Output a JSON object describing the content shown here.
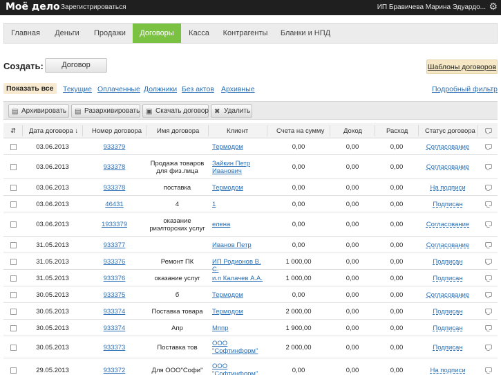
{
  "topbar": {
    "logo": "Моё дело",
    "register": "Зарегистрироваться",
    "user": "ИП Бравичева Марина Эдуардо..."
  },
  "nav": [
    "Главная",
    "Деньги",
    "Продажи",
    "Договоры",
    "Касса",
    "Контрагенты",
    "Бланки и НПД"
  ],
  "create": {
    "label": "Создать:",
    "contract_button": "Договор",
    "templates_button": "Шаблоны договоров"
  },
  "filters": {
    "show_all": "Показать все",
    "current": "Текущие",
    "paid": "Оплаченные",
    "debtors": "Должники",
    "no_acts": "Без актов",
    "archive": "Архивные",
    "advanced": "Подробный фильтр"
  },
  "toolbar": {
    "archive": "Архивировать",
    "unarchive": "Разархивировать",
    "download": "Скачать договор",
    "delete": "Удалить"
  },
  "columns": {
    "date": "Дата договора ↓",
    "number": "Номер договора",
    "name": "Имя договора",
    "client": "Клиент",
    "bills": "Счета на сумму",
    "income": "Доход",
    "expense": "Расход",
    "status": "Статус договора"
  },
  "rows": [
    {
      "date": "03.06.2013",
      "number": "933379",
      "name": "",
      "client": "Термодом",
      "bills": "0,00",
      "income": "0,00",
      "expense": "0,00",
      "status": "Согласование"
    },
    {
      "date": "03.06.2013",
      "number": "933378",
      "name": "Продажа товаров для физ.лица",
      "client": "Зайкин Петр Иванович",
      "bills": "0,00",
      "income": "0,00",
      "expense": "0,00",
      "status": "Согласование"
    },
    {
      "date": "03.06.2013",
      "number": "933378",
      "name": "поставка",
      "client": "Термодом",
      "bills": "0,00",
      "income": "0,00",
      "expense": "0,00",
      "status": "На подписи"
    },
    {
      "date": "03.06.2013",
      "number": "46431",
      "name": "4",
      "client": "1",
      "bills": "0,00",
      "income": "0,00",
      "expense": "0,00",
      "status": "Подписан"
    },
    {
      "date": "03.06.2013",
      "number": "1933379",
      "name": "оказание риэлторских услуг",
      "client": "елена",
      "bills": "0,00",
      "income": "0,00",
      "expense": "0,00",
      "status": "Согласование"
    },
    {
      "date": "31.05.2013",
      "number": "933377",
      "name": "",
      "client": "Иванов Петр",
      "bills": "0,00",
      "income": "0,00",
      "expense": "0,00",
      "status": "Согласование"
    },
    {
      "date": "31.05.2013",
      "number": "933376",
      "name": "Ремонт ПК",
      "client": "ИП Родионов В. С.",
      "bills": "1 000,00",
      "income": "0,00",
      "expense": "0,00",
      "status": "Подписан"
    },
    {
      "date": "31.05.2013",
      "number": "933376",
      "name": "оказание услуг",
      "client": "и.п Калачев А.А.",
      "bills": "1 000,00",
      "income": "0,00",
      "expense": "0,00",
      "status": "Подписан"
    },
    {
      "date": "30.05.2013",
      "number": "933375",
      "name": "б",
      "client": "Термодом",
      "bills": "0,00",
      "income": "0,00",
      "expense": "0,00",
      "status": "Согласование"
    },
    {
      "date": "30.05.2013",
      "number": "933374",
      "name": "Поставка товара",
      "client": "Термодом",
      "bills": "2 000,00",
      "income": "0,00",
      "expense": "0,00",
      "status": "Подписан"
    },
    {
      "date": "30.05.2013",
      "number": "933374",
      "name": "Апр",
      "client": "Мппр",
      "bills": "1 900,00",
      "income": "0,00",
      "expense": "0,00",
      "status": "Подписан"
    },
    {
      "date": "30.05.2013",
      "number": "933373",
      "name": "Поставка тов",
      "client": "ООО \"Софтинформ\"",
      "bills": "2 000,00",
      "income": "0,00",
      "expense": "0,00",
      "status": "Подписан"
    },
    {
      "date": "29.05.2013",
      "number": "933372",
      "name": "Для ООО\"Софи\"",
      "client": "ООО \"Софтинформ\"",
      "bills": "0,00",
      "income": "0,00",
      "expense": "0,00",
      "status": "На подписи"
    }
  ]
}
